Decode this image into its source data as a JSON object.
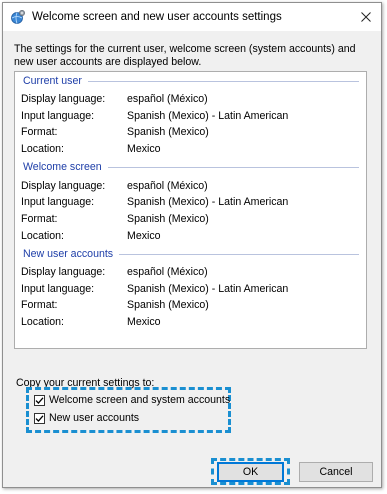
{
  "window": {
    "title": "Welcome screen and new user accounts settings",
    "icon": "globe-settings-icon",
    "close_icon": "close-icon"
  },
  "description": "The settings for the current user, welcome screen (system accounts) and new user accounts are displayed below.",
  "sections": [
    {
      "title": "Current user",
      "rows": [
        {
          "label": "Display language:",
          "value": "español (México)"
        },
        {
          "label": "Input language:",
          "value": "Spanish (Mexico) - Latin American"
        },
        {
          "label": "Format:",
          "value": "Spanish (Mexico)"
        },
        {
          "label": "Location:",
          "value": "Mexico"
        }
      ]
    },
    {
      "title": "Welcome screen",
      "rows": [
        {
          "label": "Display language:",
          "value": "español (México)"
        },
        {
          "label": "Input language:",
          "value": "Spanish (Mexico) - Latin American"
        },
        {
          "label": "Format:",
          "value": "Spanish (Mexico)"
        },
        {
          "label": "Location:",
          "value": "Mexico"
        }
      ]
    },
    {
      "title": "New user accounts",
      "rows": [
        {
          "label": "Display language:",
          "value": "español (México)"
        },
        {
          "label": "Input language:",
          "value": "Spanish (Mexico) - Latin American"
        },
        {
          "label": "Format:",
          "value": "Spanish (Mexico)"
        },
        {
          "label": "Location:",
          "value": "Mexico"
        }
      ]
    }
  ],
  "copy": {
    "label": "Copy your current settings to:",
    "options": [
      {
        "label": "Welcome screen and system accounts",
        "checked": true
      },
      {
        "label": "New user accounts",
        "checked": true
      }
    ]
  },
  "buttons": {
    "ok": "OK",
    "cancel": "Cancel"
  },
  "colors": {
    "section_title": "#1e3ea8",
    "highlight_dash": "#1a8fd1",
    "focus_border": "#0078d7"
  }
}
